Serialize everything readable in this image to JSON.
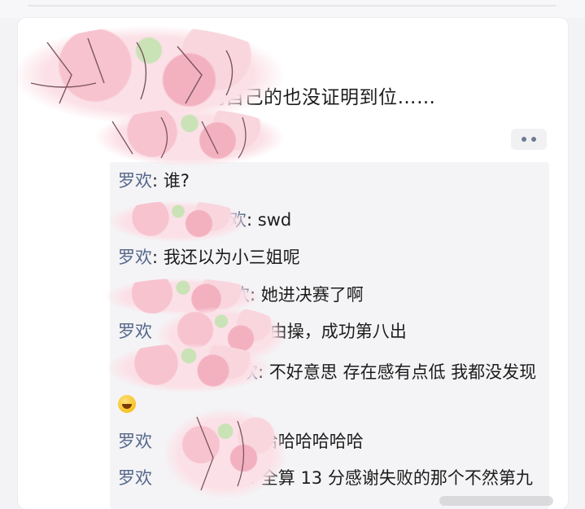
{
  "post": {
    "text": "唯一一次证明自己的也没证明到位……"
  },
  "more_icon": "more-dots-icon",
  "comments": [
    {
      "name": "罗欢",
      "sep": ": ",
      "text": "谁?"
    },
    {
      "name": "罗欢",
      "sep": ": ",
      "text": "swd"
    },
    {
      "name": "罗欢",
      "sep": ": ",
      "text": "我还以为小三姐呢"
    },
    {
      "name": "罗欢",
      "sep": ": ",
      "text": "她进决赛了啊"
    },
    {
      "name": "罗欢",
      "sep": ": ",
      "text": "自由操，成功第八出"
    },
    {
      "name": "罗欢",
      "sep": ": ",
      "text": "不好意思 存在感有点低 我都没发现"
    },
    {
      "name": "罗欢",
      "sep": ": ",
      "text": "哈哈哈哈哈哈"
    },
    {
      "name": "罗欢",
      "sep": ": ",
      "text": "全算 13 分感谢失败的那个不然第九"
    }
  ],
  "colors": {
    "name": "#56688c",
    "sticker_pink": "#f7c3cf",
    "sticker_green": "#c9e3b6"
  }
}
